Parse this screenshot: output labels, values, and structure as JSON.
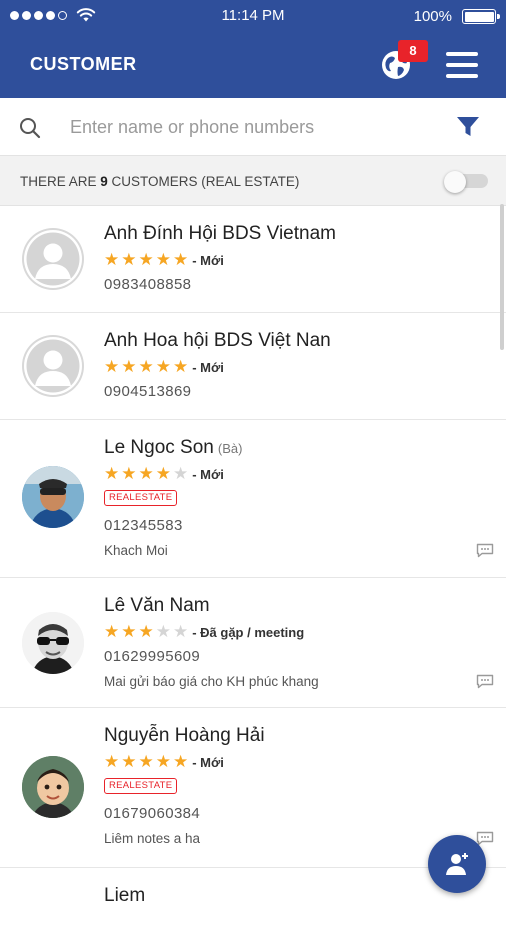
{
  "status_bar": {
    "time": "11:14 PM",
    "battery": "100%",
    "signal_bars_filled": 4,
    "signal_bars_total": 5
  },
  "header": {
    "title": "CUSTOMER",
    "notification_count": "8",
    "icons": [
      "globe-icon",
      "menu-icon"
    ]
  },
  "search": {
    "placeholder": "Enter name or phone numbers",
    "value": "",
    "icons": [
      "search-icon",
      "filter-icon"
    ]
  },
  "summary": {
    "prefix": "THERE ARE ",
    "count": "9",
    "suffix": " CUSTOMERS (REAL ESTATE)",
    "toggle_on": false
  },
  "customers": [
    {
      "name": "Anh Đính Hội BDS Vietnam",
      "title": "",
      "stars": 5,
      "status": "- Mới",
      "tag": "",
      "phone": "0983408858",
      "note": "",
      "avatar": "placeholder"
    },
    {
      "name": "Anh Hoa hội BDS Việt Nan",
      "title": "",
      "stars": 5,
      "status": "- Mới",
      "tag": "",
      "phone": "0904513869",
      "note": "",
      "avatar": "placeholder"
    },
    {
      "name": "Le Ngoc Son",
      "title": "(Bà)",
      "stars": 4,
      "status": "- Mới",
      "tag": "REALESTATE",
      "phone": "012345583",
      "note": "Khach Moi",
      "avatar": "photo"
    },
    {
      "name": "Lê Văn Nam",
      "title": "",
      "stars": 3,
      "status": "- Đã gặp / meeting",
      "tag": "",
      "phone": "01629995609",
      "note": "Mai gửi báo giá cho KH phúc khang",
      "avatar": "photo"
    },
    {
      "name": "Nguyễn Hoàng Hải",
      "title": "",
      "stars": 5,
      "status": "- Mới",
      "tag": "REALESTATE",
      "phone": "01679060384",
      "note": "Liêm notes a ha",
      "avatar": "photo"
    },
    {
      "name": "Liem",
      "title": "",
      "stars": 0,
      "status": "",
      "tag": "",
      "phone": "",
      "note": "",
      "avatar": "none"
    }
  ],
  "colors": {
    "brand": "#2f4f9b",
    "star": "#f6a623",
    "badge": "#e8232a",
    "tag": "#e8232a"
  }
}
